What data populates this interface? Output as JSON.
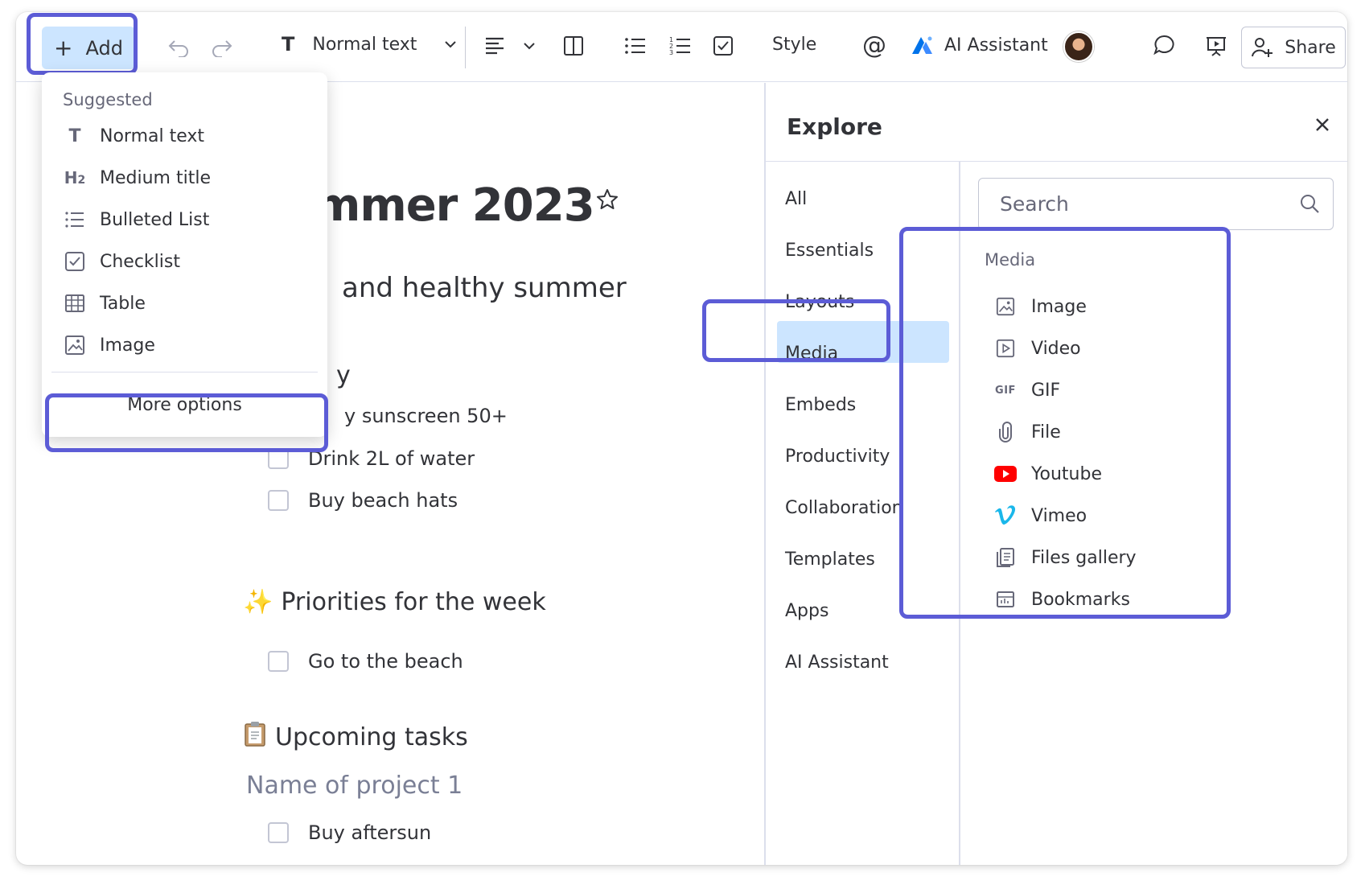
{
  "toolbar": {
    "add_label": "Add",
    "text_style": "Normal text",
    "style_label": "Style",
    "ai_label": "AI Assistant",
    "share_label": "Share"
  },
  "document": {
    "title_fragment": "mmer 2023",
    "subtitle_fragment": "and healthy summer",
    "heading_fragment": "y",
    "first_list": [
      "y sunscreen 50+",
      "Drink 2L of water",
      "Buy beach hats"
    ],
    "priorities_heading": "Priorities for the week",
    "priorities_emoji": "✨",
    "priorities": [
      "Go to the beach"
    ],
    "upcoming_heading": "Upcoming tasks",
    "upcoming_emoji": "📋",
    "project_name": "Name of project 1",
    "project_tasks": [
      "Buy aftersun"
    ]
  },
  "add_menu": {
    "heading": "Suggested",
    "items": [
      {
        "label": "Normal text",
        "icon": "text-t-icon"
      },
      {
        "label": "Medium title",
        "icon": "heading-h2-icon"
      },
      {
        "label": "Bulleted List",
        "icon": "bulleted-list-icon"
      },
      {
        "label": "Checklist",
        "icon": "checklist-icon"
      },
      {
        "label": "Table",
        "icon": "table-icon"
      },
      {
        "label": "Image",
        "icon": "image-icon"
      }
    ],
    "more_options": "More options"
  },
  "explore": {
    "title": "Explore",
    "categories": [
      "All",
      "Essentials",
      "Layouts",
      "Media",
      "Embeds",
      "Productivity",
      "Collaboration",
      "Templates",
      "Apps",
      "AI Assistant"
    ],
    "active_category": "Media",
    "search_placeholder": "Search",
    "section_heading": "Media",
    "media_items": [
      {
        "label": "Image",
        "icon": "image-icon"
      },
      {
        "label": "Video",
        "icon": "video-icon"
      },
      {
        "label": "GIF",
        "icon": "gif-icon",
        "icon_text": "GIF"
      },
      {
        "label": "File",
        "icon": "paperclip-icon"
      },
      {
        "label": "Youtube",
        "icon": "youtube-icon"
      },
      {
        "label": "Vimeo",
        "icon": "vimeo-icon"
      },
      {
        "label": "Files gallery",
        "icon": "files-gallery-icon"
      },
      {
        "label": "Bookmarks",
        "icon": "bookmark-icon"
      }
    ]
  },
  "colors": {
    "accent_highlight": "#5c5cd6",
    "selected_bg": "#cce5ff",
    "youtube_red": "#ff0000",
    "vimeo_blue": "#1ab7ea",
    "ai_blue": "#0073ea"
  }
}
